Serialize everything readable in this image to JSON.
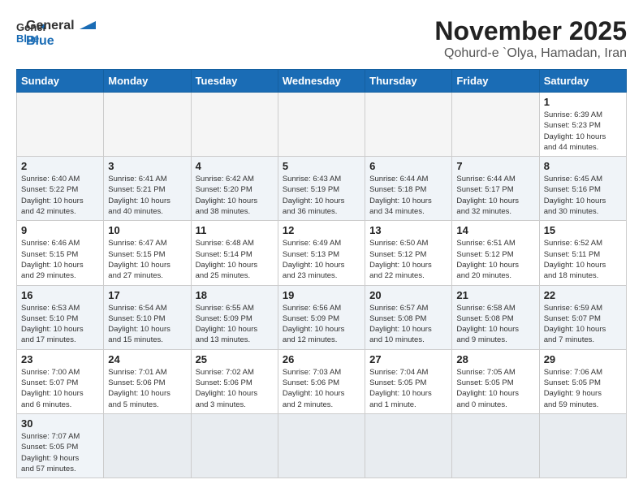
{
  "header": {
    "logo_general": "General",
    "logo_blue": "Blue",
    "title": "November 2025",
    "subtitle": "Qohurd-e `Olya, Hamadan, Iran"
  },
  "weekdays": [
    "Sunday",
    "Monday",
    "Tuesday",
    "Wednesday",
    "Thursday",
    "Friday",
    "Saturday"
  ],
  "weeks": [
    [
      {
        "day": "",
        "info": ""
      },
      {
        "day": "",
        "info": ""
      },
      {
        "day": "",
        "info": ""
      },
      {
        "day": "",
        "info": ""
      },
      {
        "day": "",
        "info": ""
      },
      {
        "day": "",
        "info": ""
      },
      {
        "day": "1",
        "info": "Sunrise: 6:39 AM\nSunset: 5:23 PM\nDaylight: 10 hours\nand 44 minutes."
      }
    ],
    [
      {
        "day": "2",
        "info": "Sunrise: 6:40 AM\nSunset: 5:22 PM\nDaylight: 10 hours\nand 42 minutes."
      },
      {
        "day": "3",
        "info": "Sunrise: 6:41 AM\nSunset: 5:21 PM\nDaylight: 10 hours\nand 40 minutes."
      },
      {
        "day": "4",
        "info": "Sunrise: 6:42 AM\nSunset: 5:20 PM\nDaylight: 10 hours\nand 38 minutes."
      },
      {
        "day": "5",
        "info": "Sunrise: 6:43 AM\nSunset: 5:19 PM\nDaylight: 10 hours\nand 36 minutes."
      },
      {
        "day": "6",
        "info": "Sunrise: 6:44 AM\nSunset: 5:18 PM\nDaylight: 10 hours\nand 34 minutes."
      },
      {
        "day": "7",
        "info": "Sunrise: 6:44 AM\nSunset: 5:17 PM\nDaylight: 10 hours\nand 32 minutes."
      },
      {
        "day": "8",
        "info": "Sunrise: 6:45 AM\nSunset: 5:16 PM\nDaylight: 10 hours\nand 30 minutes."
      }
    ],
    [
      {
        "day": "9",
        "info": "Sunrise: 6:46 AM\nSunset: 5:15 PM\nDaylight: 10 hours\nand 29 minutes."
      },
      {
        "day": "10",
        "info": "Sunrise: 6:47 AM\nSunset: 5:15 PM\nDaylight: 10 hours\nand 27 minutes."
      },
      {
        "day": "11",
        "info": "Sunrise: 6:48 AM\nSunset: 5:14 PM\nDaylight: 10 hours\nand 25 minutes."
      },
      {
        "day": "12",
        "info": "Sunrise: 6:49 AM\nSunset: 5:13 PM\nDaylight: 10 hours\nand 23 minutes."
      },
      {
        "day": "13",
        "info": "Sunrise: 6:50 AM\nSunset: 5:12 PM\nDaylight: 10 hours\nand 22 minutes."
      },
      {
        "day": "14",
        "info": "Sunrise: 6:51 AM\nSunset: 5:12 PM\nDaylight: 10 hours\nand 20 minutes."
      },
      {
        "day": "15",
        "info": "Sunrise: 6:52 AM\nSunset: 5:11 PM\nDaylight: 10 hours\nand 18 minutes."
      }
    ],
    [
      {
        "day": "16",
        "info": "Sunrise: 6:53 AM\nSunset: 5:10 PM\nDaylight: 10 hours\nand 17 minutes."
      },
      {
        "day": "17",
        "info": "Sunrise: 6:54 AM\nSunset: 5:10 PM\nDaylight: 10 hours\nand 15 minutes."
      },
      {
        "day": "18",
        "info": "Sunrise: 6:55 AM\nSunset: 5:09 PM\nDaylight: 10 hours\nand 13 minutes."
      },
      {
        "day": "19",
        "info": "Sunrise: 6:56 AM\nSunset: 5:09 PM\nDaylight: 10 hours\nand 12 minutes."
      },
      {
        "day": "20",
        "info": "Sunrise: 6:57 AM\nSunset: 5:08 PM\nDaylight: 10 hours\nand 10 minutes."
      },
      {
        "day": "21",
        "info": "Sunrise: 6:58 AM\nSunset: 5:08 PM\nDaylight: 10 hours\nand 9 minutes."
      },
      {
        "day": "22",
        "info": "Sunrise: 6:59 AM\nSunset: 5:07 PM\nDaylight: 10 hours\nand 7 minutes."
      }
    ],
    [
      {
        "day": "23",
        "info": "Sunrise: 7:00 AM\nSunset: 5:07 PM\nDaylight: 10 hours\nand 6 minutes."
      },
      {
        "day": "24",
        "info": "Sunrise: 7:01 AM\nSunset: 5:06 PM\nDaylight: 10 hours\nand 5 minutes."
      },
      {
        "day": "25",
        "info": "Sunrise: 7:02 AM\nSunset: 5:06 PM\nDaylight: 10 hours\nand 3 minutes."
      },
      {
        "day": "26",
        "info": "Sunrise: 7:03 AM\nSunset: 5:06 PM\nDaylight: 10 hours\nand 2 minutes."
      },
      {
        "day": "27",
        "info": "Sunrise: 7:04 AM\nSunset: 5:05 PM\nDaylight: 10 hours\nand 1 minute."
      },
      {
        "day": "28",
        "info": "Sunrise: 7:05 AM\nSunset: 5:05 PM\nDaylight: 10 hours\nand 0 minutes."
      },
      {
        "day": "29",
        "info": "Sunrise: 7:06 AM\nSunset: 5:05 PM\nDaylight: 9 hours\nand 59 minutes."
      }
    ],
    [
      {
        "day": "30",
        "info": "Sunrise: 7:07 AM\nSunset: 5:05 PM\nDaylight: 9 hours\nand 57 minutes."
      },
      {
        "day": "",
        "info": ""
      },
      {
        "day": "",
        "info": ""
      },
      {
        "day": "",
        "info": ""
      },
      {
        "day": "",
        "info": ""
      },
      {
        "day": "",
        "info": ""
      },
      {
        "day": "",
        "info": ""
      }
    ]
  ]
}
